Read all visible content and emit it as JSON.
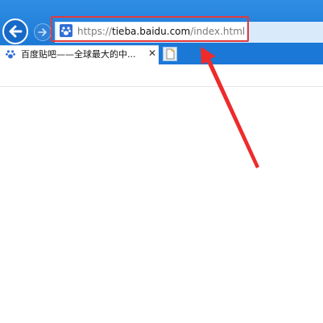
{
  "browser": {
    "url_scheme": "https://",
    "url_host": "tieba.baidu.com",
    "url_path": "/index.html",
    "tab_title": "百度贴吧——全球最大的中...",
    "close_glyph": "✕"
  },
  "icons": {
    "back": "back-arrow-icon",
    "forward": "forward-arrow-icon",
    "site": "baidu-paw-icon",
    "new_tab": "new-tab-icon"
  },
  "colors": {
    "toolbar_blue": "#1b78d6",
    "highlight_red": "#e33a3a",
    "arrow_red": "#ee2b2b"
  }
}
